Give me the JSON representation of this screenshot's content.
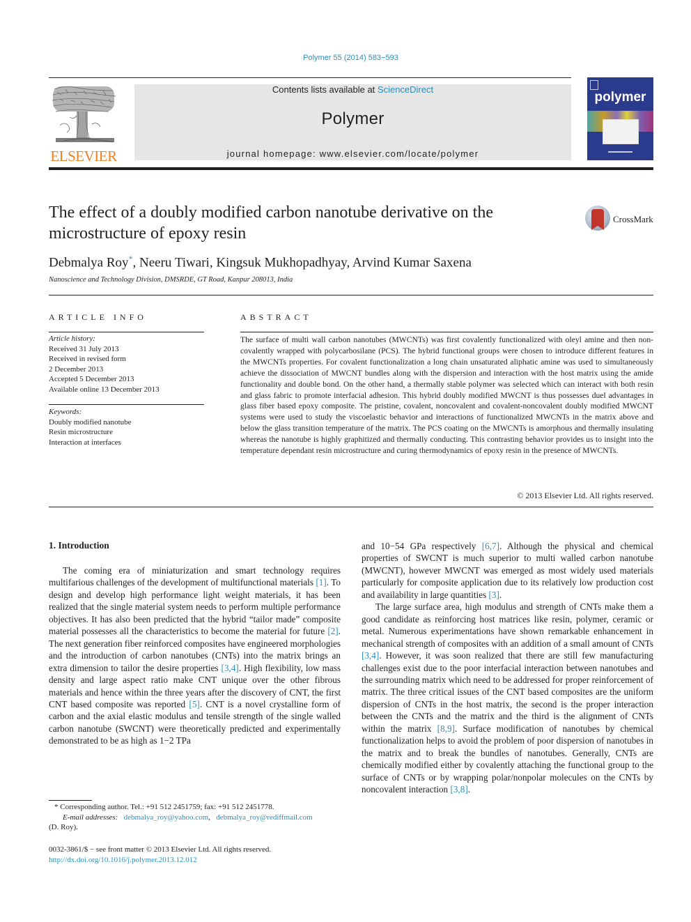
{
  "citation": "Polymer 55 (2014) 583−593",
  "masthead": {
    "contents_prefix": "Contents lists available at ",
    "contents_link": "ScienceDirect",
    "journal_name": "Polymer",
    "homepage": "journal homepage: www.elsevier.com/locate/polymer"
  },
  "publisher_logo": "ELSEVIER",
  "cover": {
    "word": "polymer"
  },
  "crossmark": "CrossMark",
  "title": "The effect of a doubly modified carbon nanotube derivative on the microstructure of epoxy resin",
  "authors": {
    "first": "Debmalya Roy",
    "star": "*",
    "rest": ", Neeru Tiwari, Kingsuk Mukhopadhyay, Arvind Kumar Saxena"
  },
  "affiliation": "Nanoscience and Technology Division, DMSRDE, GT Road, Kanpur 208013, India",
  "article_info": {
    "heading": "ARTICLE INFO",
    "history_label": "Article history:",
    "history": [
      "Received 31 July 2013",
      "Received in revised form",
      "2 December 2013",
      "Accepted 5 December 2013",
      "Available online 13 December 2013"
    ],
    "keywords_label": "Keywords:",
    "keywords": [
      "Doubly modified nanotube",
      "Resin microstructure",
      "Interaction at interfaces"
    ]
  },
  "abstract": {
    "heading": "ABSTRACT",
    "text": "The surface of multi wall carbon nanotubes (MWCNTs) was first covalently functionalized with oleyl amine and then non-covalently wrapped with polycarbosilane (PCS). The hybrid functional groups were chosen to introduce different features in the MWCNTs properties. For covalent functionalization a long chain unsaturated aliphatic amine was used to simultaneously achieve the dissociation of MWCNT bundles along with the dispersion and interaction with the host matrix using the amide functionality and double bond. On the other hand, a thermally stable polymer was selected which can interact with both resin and glass fabric to promote interfacial adhesion. This hybrid doubly modified MWCNT is thus possesses duel advantages in glass fiber based epoxy composite. The pristine, covalent, noncovalent and covalent-noncovalent doubly modified MWCNT systems were used to study the viscoelastic behavior and interactions of functionalized MWCNTs in the matrix above and below the glass transition temperature of the matrix. The PCS coating on the MWCNTs is amorphous and thermally insulating whereas the nanotube is highly graphitized and thermally conducting. This contrasting behavior provides us to insight into the temperature dependant resin microstructure and curing thermodynamics of epoxy resin in the presence of MWCNTs.",
    "copyright": "© 2013 Elsevier Ltd. All rights reserved."
  },
  "section": {
    "title": "1.  Introduction",
    "left_paragraph": [
      {
        "t": "The coming era of miniaturization and smart technology requires multifarious challenges of the development of multifunctional materials "
      },
      {
        "r": "[1]"
      },
      {
        "t": ". To design and develop high performance light weight materials, it has been realized that the single material system needs to perform multiple performance objectives. It has also been predicted that the hybrid “tailor made” composite material possesses all the characteristics to become the material for future "
      },
      {
        "r": "[2]"
      },
      {
        "t": ". The next generation fiber reinforced composites have engineered morphologies and the introduction of carbon nanotubes (CNTs) into the matrix brings an extra dimension to tailor the desire properties "
      },
      {
        "r": "[3,4]"
      },
      {
        "t": ". High flexibility, low mass density and large aspect ratio make CNT unique over the other fibrous materials and hence within the three years after the discovery of CNT, the first CNT based composite was reported "
      },
      {
        "r": "[5]"
      },
      {
        "t": ". CNT is a novel crystalline form of carbon and the axial elastic modulus and tensile strength of the single walled carbon nanotube (SWCNT) were theoretically predicted and experimentally demonstrated to be as high as 1−2 TPa"
      }
    ],
    "right_paragraph_1": [
      {
        "t": "and 10−54 GPa respectively "
      },
      {
        "r": "[6,7]"
      },
      {
        "t": ". Although the physical and chemical properties of SWCNT is much superior to multi walled carbon nanotube (MWCNT), however MWCNT was emerged as most widely used materials particularly for composite application due to its relatively low production cost and availability in large quantities "
      },
      {
        "r": "[3]"
      },
      {
        "t": "."
      }
    ],
    "right_paragraph_2": [
      {
        "t": "The large surface area, high modulus and strength of CNTs make them a good candidate as reinforcing host matrices like resin, polymer, ceramic or metal. Numerous experimentations have shown remarkable enhancement in mechanical strength of composites with an addition of a small amount of CNTs "
      },
      {
        "r": "[3,4]"
      },
      {
        "t": ". However, it was soon realized that there are still few manufacturing challenges exist due to the poor interfacial interaction between nanotubes and the surrounding matrix which need to be addressed for proper reinforcement of matrix. The three critical issues of the CNT based composites are the uniform dispersion of CNTs in the host matrix, the second is the proper interaction between the CNTs and the matrix and the third is the alignment of CNTs within the matrix "
      },
      {
        "r": "[8,9]"
      },
      {
        "t": ". Surface modification of nanotubes by chemical functionalization helps to avoid the problem of poor dispersion of nanotubes in the matrix and to break the bundles of nanotubes. Generally, CNTs are chemically modified either by covalently attaching the functional group to the surface of CNTs or by wrapping polar/nonpolar molecules on the CNTs by noncovalent interaction "
      },
      {
        "r": "[3,8]"
      },
      {
        "t": "."
      }
    ]
  },
  "footnote": {
    "star_line": "* Corresponding author. Tel.: +91 512 2451759; fax: +91 512 2451778.",
    "email_label": "E-mail addresses:",
    "email1": "debmalya_roy@yahoo.com",
    "email2": "debmalya_roy@rediffmail.com",
    "name": "(D. Roy)."
  },
  "frontmatter": {
    "issn_line": "0032-3861/$ − see front matter © 2013 Elsevier Ltd. All rights reserved.",
    "doi": "http://dx.doi.org/10.1016/j.polymer.2013.12.012"
  },
  "colors": {
    "link": "#2a8fbd",
    "elsevier_orange": "#f07f1d",
    "masthead_gray": "#e6e6e6",
    "cover_blue": "#2a3a8c",
    "text": "#231f20"
  }
}
